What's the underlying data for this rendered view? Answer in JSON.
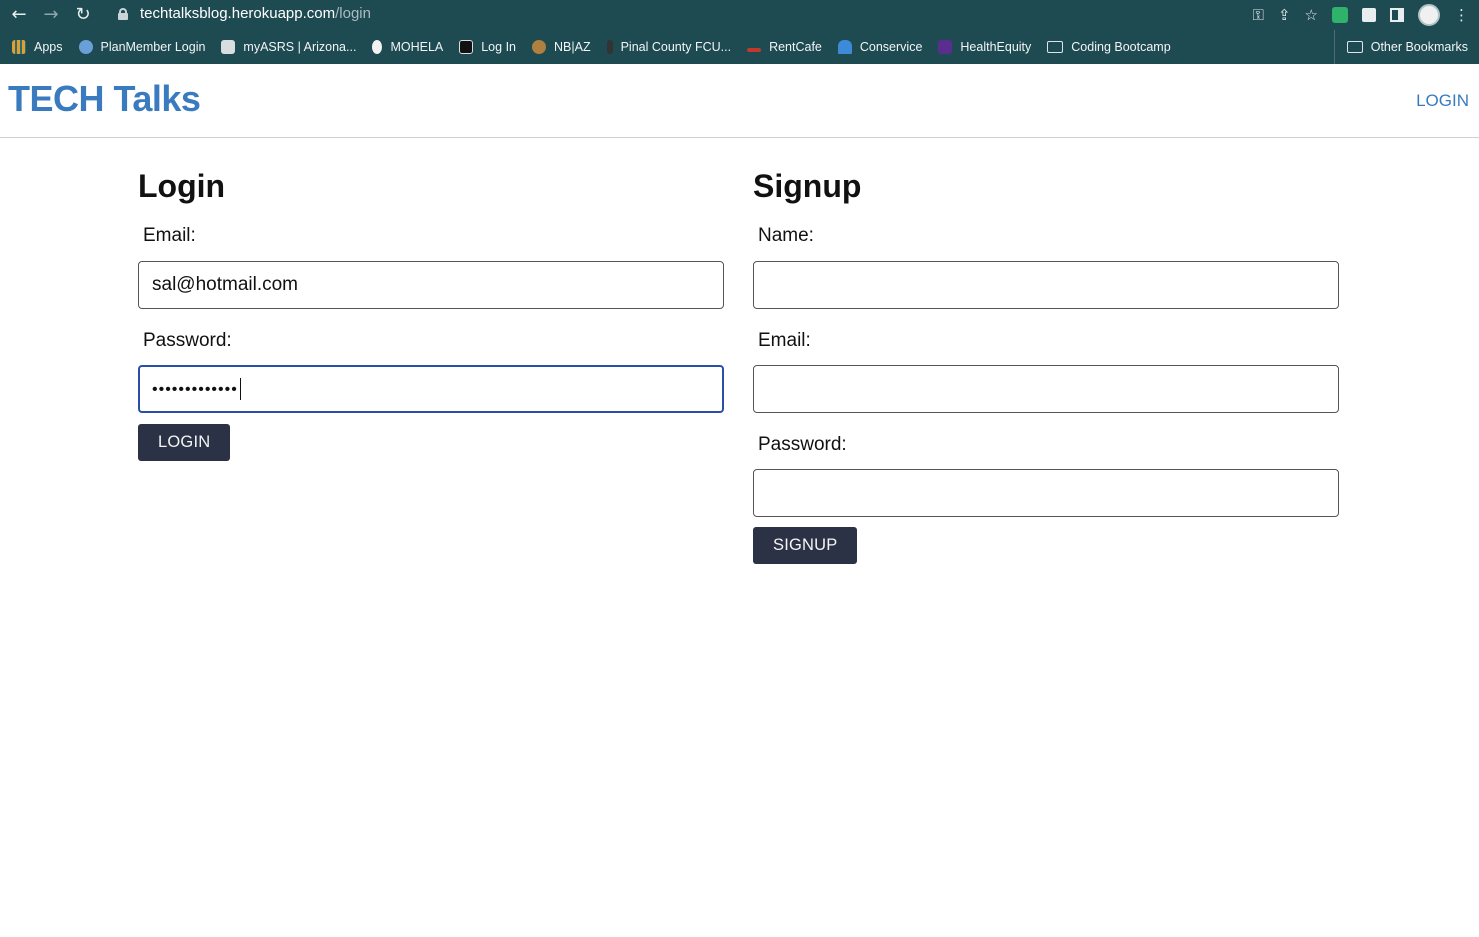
{
  "browser": {
    "url_host": "techtalksblog.herokuapp.com",
    "url_path": "/login",
    "bookmarks": [
      {
        "label": "Apps",
        "color": "#e0a030"
      },
      {
        "label": "PlanMember Login",
        "color": "#6aa0d8"
      },
      {
        "label": "myASRS | Arizona...",
        "color": "#d8dde0"
      },
      {
        "label": "MOHELA",
        "color": "#f2f2f2"
      },
      {
        "label": "Log In",
        "color": "#111111"
      },
      {
        "label": "NB|AZ",
        "color": "#b08040"
      },
      {
        "label": "Pinal County FCU...",
        "color": "#333333"
      },
      {
        "label": "RentCafe",
        "color": "#c0392b"
      },
      {
        "label": "Conservice",
        "color": "#3c8ad8"
      },
      {
        "label": "HealthEquity",
        "color": "#5b2d8f"
      },
      {
        "label": "Coding Bootcamp",
        "color": "#dfe6e8"
      }
    ],
    "other_bookmarks": "Other Bookmarks"
  },
  "header": {
    "brand": "TECH Talks",
    "login_link": "LOGIN",
    "accent": "#3a7bbf"
  },
  "login": {
    "title": "Login",
    "email_label": "Email:",
    "email_value": "sal@hotmail.com",
    "password_label": "Password:",
    "password_value": "•••••••••••••",
    "button": "LOGIN"
  },
  "signup": {
    "title": "Signup",
    "name_label": "Name:",
    "email_label": "Email:",
    "password_label": "Password:",
    "button": "SIGNUP"
  }
}
